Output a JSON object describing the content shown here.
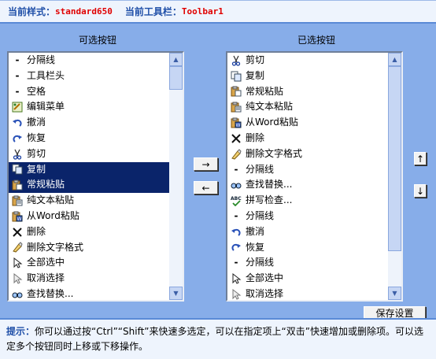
{
  "header": {
    "style_label": "当前样式：",
    "style_value": "standard650",
    "toolbar_label": "当前工具栏：",
    "toolbar_value": "Toolbar1"
  },
  "available": {
    "title": "可选按钮",
    "items": [
      {
        "icon": "separator-icon",
        "label": "分隔线",
        "selected": false
      },
      {
        "icon": "separator-icon",
        "label": "工具栏头",
        "selected": false
      },
      {
        "icon": "separator-icon",
        "label": "空格",
        "selected": false
      },
      {
        "icon": "edit-menu-icon",
        "label": "编辑菜单",
        "selected": false
      },
      {
        "icon": "undo-icon",
        "label": "撤消",
        "selected": false
      },
      {
        "icon": "redo-icon",
        "label": "恢复",
        "selected": false
      },
      {
        "icon": "cut-icon",
        "label": "剪切",
        "selected": false
      },
      {
        "icon": "copy-icon",
        "label": "复制",
        "selected": true
      },
      {
        "icon": "paste-icon",
        "label": "常规粘贴",
        "selected": true
      },
      {
        "icon": "paste-text-icon",
        "label": "纯文本粘贴",
        "selected": false
      },
      {
        "icon": "paste-word-icon",
        "label": "从Word粘贴",
        "selected": false
      },
      {
        "icon": "delete-icon",
        "label": "删除",
        "selected": false
      },
      {
        "icon": "remove-format-icon",
        "label": "删除文字格式",
        "selected": false
      },
      {
        "icon": "select-all-icon",
        "label": "全部选中",
        "selected": false
      },
      {
        "icon": "cursor-icon",
        "label": "取消选择",
        "selected": false
      },
      {
        "icon": "find-icon",
        "label": "查找替换...",
        "selected": false
      }
    ],
    "scroll_fraction": 0.0
  },
  "chosen": {
    "title": "已选按钮",
    "items": [
      {
        "icon": "cut-icon",
        "label": "剪切"
      },
      {
        "icon": "copy-icon",
        "label": "复制"
      },
      {
        "icon": "paste-icon",
        "label": "常规粘贴"
      },
      {
        "icon": "paste-text-icon",
        "label": "纯文本粘贴"
      },
      {
        "icon": "paste-word-icon",
        "label": "从Word粘贴"
      },
      {
        "icon": "delete-icon",
        "label": "删除"
      },
      {
        "icon": "remove-format-icon",
        "label": "删除文字格式"
      },
      {
        "icon": "separator-icon",
        "label": "分隔线"
      },
      {
        "icon": "find-icon",
        "label": "查找替换..."
      },
      {
        "icon": "spellcheck-icon",
        "label": "拼写检查..."
      },
      {
        "icon": "separator-icon",
        "label": "分隔线"
      },
      {
        "icon": "undo-icon",
        "label": "撤消"
      },
      {
        "icon": "redo-icon",
        "label": "恢复"
      },
      {
        "icon": "separator-icon",
        "label": "分隔线"
      },
      {
        "icon": "select-all-icon",
        "label": "全部选中"
      },
      {
        "icon": "cursor-icon",
        "label": "取消选择"
      }
    ],
    "scroll_fraction": 0.0
  },
  "buttons": {
    "add": "→",
    "remove": "←",
    "move_up": "↑",
    "move_down": "↓",
    "save": "保存设置"
  },
  "footer": {
    "tip_label": "提示：",
    "tip_text": "你可以通过按“Ctrl”“Shift”来快速多选定，可以在指定项上“双击”快速增加或删除项。可以选定多个按钮同时上移或下移操作。"
  },
  "colors": {
    "panel_bg": "#87ade9",
    "selection": "#0a246a",
    "header_value": "#e00000",
    "header_label": "#1f4fa8"
  }
}
